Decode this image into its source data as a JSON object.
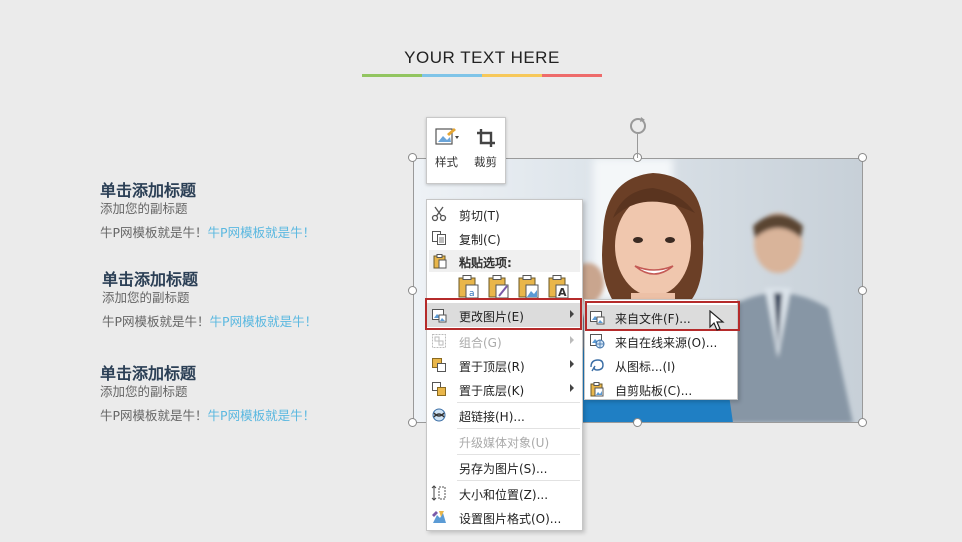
{
  "slide": {
    "title": "YOUR TEXT HERE",
    "title_bar_colors": [
      "#92c560",
      "#7fc4e8",
      "#f7c85a",
      "#ee6b6b"
    ]
  },
  "blocks": [
    {
      "heading": "单击添加标题",
      "subtitle": "添加您的副标题",
      "body_plain": "牛P网模板就是牛！",
      "body_highlight": "牛P网模板就是牛！"
    },
    {
      "heading": "单击添加标题",
      "subtitle": "添加您的副标题",
      "body_plain": "牛P网模板就是牛！",
      "body_highlight": "牛P网模板就是牛！"
    },
    {
      "heading": "单击添加标题",
      "subtitle": "添加您的副标题",
      "body_plain": "牛P网模板就是牛！",
      "body_highlight": "牛P网模板就是牛！"
    }
  ],
  "mini_toolbar": {
    "style_label": "样式",
    "crop_label": "裁剪"
  },
  "context_menu": {
    "cut": "剪切(T)",
    "copy": "复制(C)",
    "paste_options": "粘贴选项:",
    "change_picture": "更改图片(E)",
    "group": "组合(G)",
    "bring_front": "置于顶层(R)",
    "send_back": "置于底层(K)",
    "hyperlink": "超链接(H)...",
    "upgrade_media": "升级媒体对象(U)",
    "save_as_picture": "另存为图片(S)...",
    "size_position": "大小和位置(Z)...",
    "format_picture": "设置图片格式(O)..."
  },
  "submenu": {
    "from_file": "来自文件(F)...",
    "from_online": "来自在线来源(O)...",
    "from_icons": "从图标...(I)",
    "from_clipboard": "自剪贴板(C)..."
  },
  "colors": {
    "accent_red_box": "#b52b2b",
    "heading": "#2b3f55",
    "highlight_text": "#5bb8e0"
  }
}
